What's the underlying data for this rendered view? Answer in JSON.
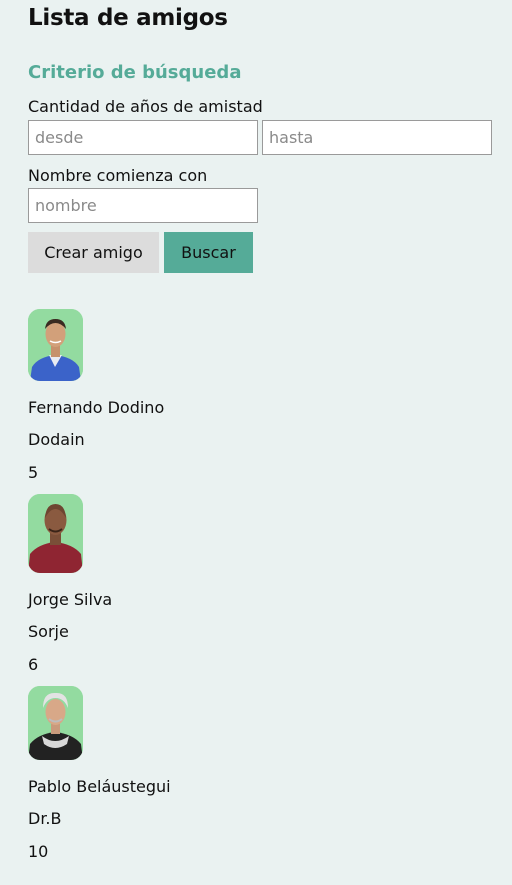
{
  "page": {
    "title": "Lista de amigos"
  },
  "search": {
    "section_title": "Criterio de búsqueda",
    "years_label": "Cantidad de años de amistad",
    "from_placeholder": "desde",
    "to_placeholder": "hasta",
    "name_label": "Nombre comienza con",
    "name_placeholder": "nombre",
    "create_button": "Crear amigo",
    "search_button": "Buscar"
  },
  "friends": [
    {
      "name": "Fernando Dodino",
      "nickname": "Dodain",
      "years": "5"
    },
    {
      "name": "Jorge Silva",
      "nickname": "Sorje",
      "years": "6"
    },
    {
      "name": "Pablo Beláustegui",
      "nickname": "Dr.B",
      "years": "10"
    }
  ],
  "colors": {
    "accent": "#55ab98",
    "background": "#eaf2f1",
    "secondary_button": "#dcdcdc"
  }
}
